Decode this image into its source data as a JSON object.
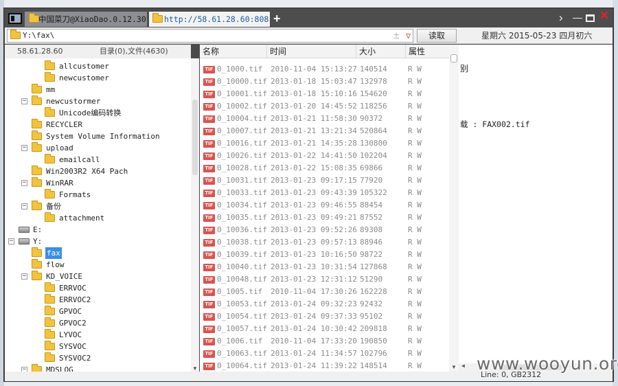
{
  "tabs": [
    {
      "label": "中国菜刀@XiaoDao.0.12.30"
    },
    {
      "label": "http://58.61.28.60:808..."
    }
  ],
  "window_controls": {
    "new_tab": "+",
    "next": "›",
    "min": "—",
    "close": "✕"
  },
  "toolbar": {
    "path": "Y:\\fax\\",
    "plus": "±",
    "dropdown": "▽",
    "read_button": "读取",
    "date": "星期六 2015-05-23 四月初六"
  },
  "left_header": {
    "ip": "58.61.28.60",
    "counts": "目录(0),文件(4630)"
  },
  "tree": [
    {
      "label": "allcustomer"
    },
    {
      "label": "newcustomer"
    },
    {
      "label": "mm"
    },
    {
      "label": "newcustormer",
      "toggle": "⊟"
    },
    {
      "label": "Unicode编码转换"
    },
    {
      "label": "RECYCLER"
    },
    {
      "label": "System Volume Information"
    },
    {
      "label": "upload",
      "toggle": "⊟"
    },
    {
      "label": "emailcall"
    },
    {
      "label": "Win2003R2 X64 Pach"
    },
    {
      "label": "WinRAR",
      "toggle": "⊟"
    },
    {
      "label": "Formats"
    },
    {
      "label": "备份",
      "toggle": "⊟"
    },
    {
      "label": "attachment"
    },
    {
      "label": "E:"
    },
    {
      "label": "Y:",
      "toggle": "⊟"
    },
    {
      "label": "fax"
    },
    {
      "label": "flow"
    },
    {
      "label": "KD_VOICE",
      "toggle": "⊟"
    },
    {
      "label": "ERRVOC"
    },
    {
      "label": "ERRVOC2"
    },
    {
      "label": "GPVOC"
    },
    {
      "label": "GPVOC2"
    },
    {
      "label": "LYVOC"
    },
    {
      "label": "SYSVOC"
    },
    {
      "label": "SYSVOC2"
    },
    {
      "label": "MDSLOG"
    }
  ],
  "columns": {
    "name": "名称",
    "time": "时间",
    "size": "大小",
    "attr": "属性"
  },
  "file_icon_label": "TIF",
  "files": [
    {
      "name": "0_1000.tif",
      "time": "2010-11-04 15:13:27",
      "size": "140514",
      "attr": "R W"
    },
    {
      "name": "0_10000.tif",
      "time": "2013-01-18 15:03:47",
      "size": "132978",
      "attr": "R W"
    },
    {
      "name": "0_10001.tif",
      "time": "2013-01-18 15:10:16",
      "size": "154620",
      "attr": "R W"
    },
    {
      "name": "0_10002.tif",
      "time": "2013-01-20 14:45:52",
      "size": "118256",
      "attr": "R W"
    },
    {
      "name": "0_10004.tif",
      "time": "2013-01-21 11:58:30",
      "size": "90372",
      "attr": "R W"
    },
    {
      "name": "0_10007.tif",
      "time": "2013-01-21 13:21:34",
      "size": "520864",
      "attr": "R W"
    },
    {
      "name": "0_10016.tif",
      "time": "2013-01-21 14:35:28",
      "size": "130800",
      "attr": "R W"
    },
    {
      "name": "0_10026.tif",
      "time": "2013-01-22 14:41:50",
      "size": "102204",
      "attr": "R W"
    },
    {
      "name": "0_10028.tif",
      "time": "2013-01-22 15:08:35",
      "size": "69866",
      "attr": "R W"
    },
    {
      "name": "0_10031.tif",
      "time": "2013-01-23 09:17:15",
      "size": "77920",
      "attr": "R W"
    },
    {
      "name": "0_10033.tif",
      "time": "2013-01-23 09:43:39",
      "size": "105322",
      "attr": "R W"
    },
    {
      "name": "0_10034.tif",
      "time": "2013-01-23 09:46:55",
      "size": "88454",
      "attr": "R W"
    },
    {
      "name": "0_10035.tif",
      "time": "2013-01-23 09:49:21",
      "size": "87552",
      "attr": "R W"
    },
    {
      "name": "0_10036.tif",
      "time": "2013-01-23 09:52:26",
      "size": "89308",
      "attr": "R W"
    },
    {
      "name": "0_10038.tif",
      "time": "2013-01-23 09:57:13",
      "size": "88946",
      "attr": "R W"
    },
    {
      "name": "0_10039.tif",
      "time": "2013-01-23 10:16:50",
      "size": "98722",
      "attr": "R W"
    },
    {
      "name": "0_10040.tif",
      "time": "2013-01-23 10:31:54",
      "size": "127868",
      "attr": "R W"
    },
    {
      "name": "0_10048.tif",
      "time": "2013-01-23 12:31:12",
      "size": "51290",
      "attr": "R W"
    },
    {
      "name": "0_1005.tif",
      "time": "2010-11-04 17:30:26",
      "size": "162228",
      "attr": "R W"
    },
    {
      "name": "0_10053.tif",
      "time": "2013-01-24 09:32:23",
      "size": "92432",
      "attr": "R W"
    },
    {
      "name": "0_10054.tif",
      "time": "2013-01-24 09:37:33",
      "size": "95102",
      "attr": "R W"
    },
    {
      "name": "0_10057.tif",
      "time": "2013-01-24 10:30:42",
      "size": "209818",
      "attr": "R W"
    },
    {
      "name": "0_1006.tif",
      "time": "2010-11-04 17:33:20",
      "size": "190850",
      "attr": "R W"
    },
    {
      "name": "0_10063.tif",
      "time": "2013-01-24 11:34:57",
      "size": "102796",
      "attr": "R W"
    },
    {
      "name": "0_10064.tif",
      "time": "2013-01-24 11:39:22",
      "size": "148514",
      "attr": "R W"
    }
  ],
  "right_pane": {
    "line1": "别",
    "line2": "载 : FAX002.tif"
  },
  "status": {
    "text": "Line: 0, GB2312"
  },
  "watermark": "www.wooyun.org",
  "colors": {
    "selection": "#3a8ee6",
    "tif_badge": "#d9534f",
    "close_button": "#e02424",
    "link_tab": "#1b5aa3"
  }
}
